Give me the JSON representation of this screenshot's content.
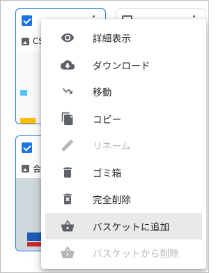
{
  "cards": [
    {
      "title": "CS",
      "checked": true
    },
    {
      "title": "",
      "checked": false
    },
    {
      "title": "会",
      "checked": true
    },
    {
      "title": "",
      "checked": false
    }
  ],
  "menu": {
    "items": [
      {
        "label": "詳細表示",
        "icon": "eye-icon",
        "state": "normal"
      },
      {
        "label": "ダウンロード",
        "icon": "cloud-download-icon",
        "state": "normal"
      },
      {
        "label": "移動",
        "icon": "move-arrow-icon",
        "state": "normal"
      },
      {
        "label": "コピー",
        "icon": "copy-icon",
        "state": "normal"
      },
      {
        "label": "リネーム",
        "icon": "pencil-icon",
        "state": "disabled"
      },
      {
        "label": "ゴミ箱",
        "icon": "trash-icon",
        "state": "normal"
      },
      {
        "label": "完全削除",
        "icon": "delete-forever-icon",
        "state": "normal"
      },
      {
        "label": "バスケットに追加",
        "icon": "basket-add-icon",
        "state": "hover"
      },
      {
        "label": "バスケットから削除",
        "icon": "basket-remove-icon",
        "state": "disabled"
      }
    ]
  },
  "colors": {
    "accent": "#1a73e8",
    "icon": "#5f6368",
    "disabled": "#b6b6b6",
    "hover_bg": "#e9e9e9"
  }
}
